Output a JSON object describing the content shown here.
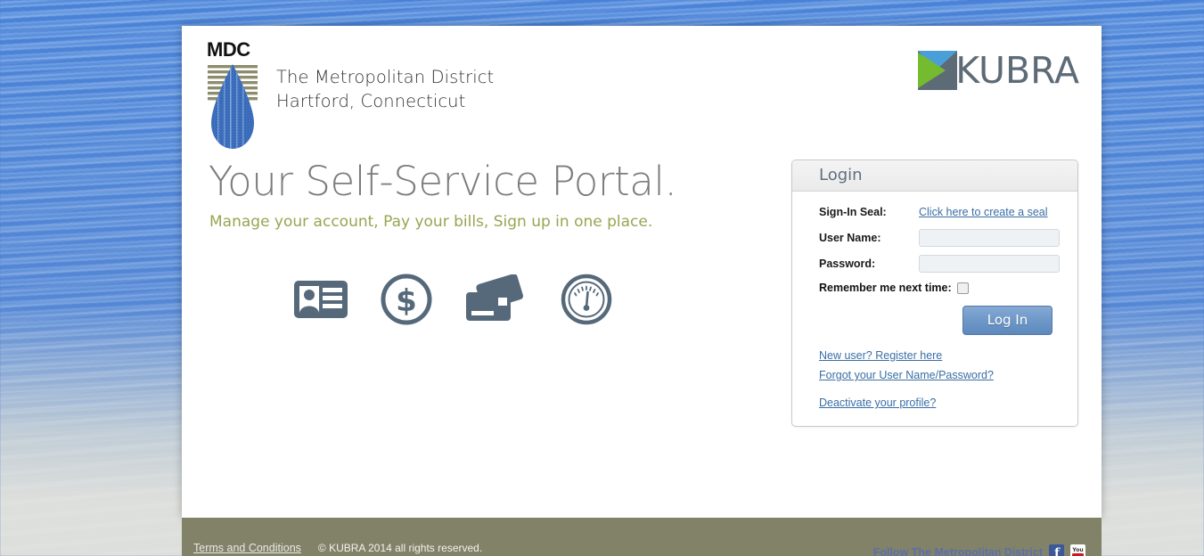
{
  "brand": {
    "mdc_wordmark": "MDC",
    "mdc_line1": "The Metropolitan District",
    "mdc_line2": "Hartford, Connecticut",
    "mdc_mark_icon": "water-droplet-icon",
    "kubra_word": "KUBRA",
    "kubra_mark_icon": "kubra-triangle-icon"
  },
  "hero": {
    "title": "Your Self-Service Portal.",
    "subtitle": "Manage your account, Pay your bills, Sign up in one place.",
    "features": [
      {
        "icon": "id-card-icon",
        "name": "account-icon"
      },
      {
        "icon": "dollar-circle-icon",
        "name": "billing-icon"
      },
      {
        "icon": "credit-cards-icon",
        "name": "payment-icon"
      },
      {
        "icon": "gauge-meter-icon",
        "name": "usage-icon"
      }
    ]
  },
  "login": {
    "panel_title": "Login",
    "seal_label": "Sign-In Seal:",
    "seal_link": "Click here to create a seal",
    "username_label": "User Name:",
    "username_value": "",
    "username_placeholder": "",
    "password_label": "Password:",
    "password_value": "",
    "password_placeholder": "",
    "remember_label": "Remember me next time:",
    "remember_checked": false,
    "submit_label": "Log In",
    "register_link": "New user? Register here",
    "forgot_link": "Forgot your User Name/Password?",
    "deactivate_link": "Deactivate your profile?"
  },
  "footer": {
    "terms_link": "Terms and Conditions",
    "copyright": "© KUBRA 2014 all rights reserved.",
    "follow_text": "Follow The Metropolitan District",
    "social": [
      {
        "name": "facebook-icon",
        "label": "f"
      },
      {
        "name": "youtube-icon",
        "label": "You"
      }
    ]
  },
  "colors": {
    "accent_blue": "#6e98c8",
    "link_blue": "#3a6ea5",
    "subtitle_olive": "#9aa451",
    "footer_olive": "#828269",
    "icon_slate": "#56697a",
    "kubra_gray": "#5d6b77",
    "water_blue": "#4a82d8"
  }
}
